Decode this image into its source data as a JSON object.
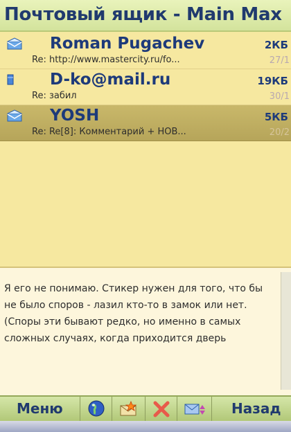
{
  "window": {
    "title": "Почтовый ящик - Main Max"
  },
  "messages": [
    {
      "sender": "Roman Pugachev",
      "subject": "Re: http://www.mastercity.ru/fo...",
      "size": "2КБ",
      "date": "27/1",
      "icon": "envelope-open-icon",
      "selected": false
    },
    {
      "sender": "D-ko@mail.ru",
      "subject": "Re: забил",
      "size": "19КБ",
      "date": "30/1",
      "icon": "envelope-closed-icon",
      "selected": false
    },
    {
      "sender": "YOSH",
      "subject": "Re: Re[8]: Комментарий + НОВ...",
      "size": "5КБ",
      "date": "20/2",
      "icon": "envelope-open-icon",
      "selected": true
    }
  ],
  "preview": {
    "body": "Я его не понимаю. Стикер нужен для того, что бы не было споров - лазил кто-то в замок или нет. (Споры эти бывают редко, но именно в самых сложных случаях, когда приходится дверь"
  },
  "toolbar": {
    "menu_label": "Меню",
    "back_label": "Назад",
    "icons": [
      "globe-icon",
      "new-message-icon",
      "delete-icon",
      "send-receive-icon"
    ]
  },
  "colors": {
    "title_text": "#203a6e",
    "list_background": "#f6e8a0",
    "selected_row": "#b6a55a",
    "toolbar": "#c4d690"
  }
}
